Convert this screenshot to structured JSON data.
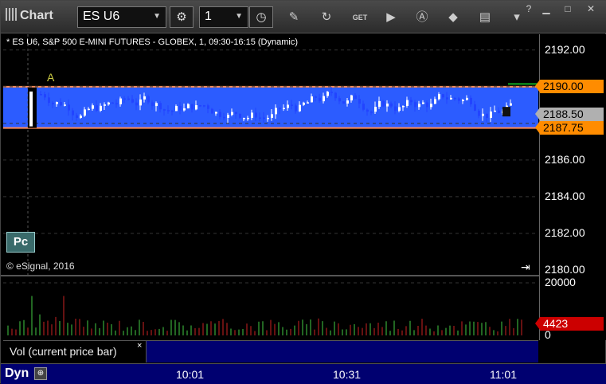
{
  "toolbar": {
    "title": "Chart",
    "symbol": "ES U6",
    "interval": "1",
    "icons": [
      "gear-icon",
      "clock-icon",
      "pencil-icon",
      "refresh-icon",
      "get-icon",
      "play-icon",
      "alert-icon",
      "tag-icon",
      "chat-icon"
    ],
    "get_label": "GET",
    "window_icons": [
      "help-icon",
      "minimize-icon",
      "maximize-icon",
      "close-icon"
    ]
  },
  "chart": {
    "header": "* ES U6, S&P 500 E-MINI FUTURES - GLOBEX, 1, 09:30-16:15 (Dynamic)",
    "copyright": "© eSignal, 2016",
    "marker_a": "A",
    "pc_label": "Pc",
    "y_ticks": [
      "2192.00",
      "2190.00",
      "2188.00",
      "2186.00",
      "2184.00",
      "2182.00",
      "2180.00"
    ],
    "price_tags": [
      {
        "label": "2190.00",
        "color": "#ff8c00"
      },
      {
        "label": "2188.50",
        "color": "#b0b0b0"
      },
      {
        "label": "2187.75",
        "color": "#ff8c00"
      }
    ],
    "band_color": "#2c5cff",
    "band_edge_color": "#ff8c55"
  },
  "chart_data": {
    "type": "candlestick",
    "ylim": [
      2180,
      2192.6
    ],
    "band": [
      2187.75,
      2190.0
    ],
    "last": 2188.5
  },
  "volume": {
    "label": "Vol (current price bar)",
    "close_label": "×",
    "y_ticks": [
      "20000",
      "0"
    ],
    "last_tag": "4423",
    "last_color": "#cc0000",
    "ylim": [
      0,
      20000
    ]
  },
  "timeaxis": {
    "dyn_label": "Dyn",
    "ticks": [
      "10:01",
      "10:31",
      "11:01"
    ]
  }
}
